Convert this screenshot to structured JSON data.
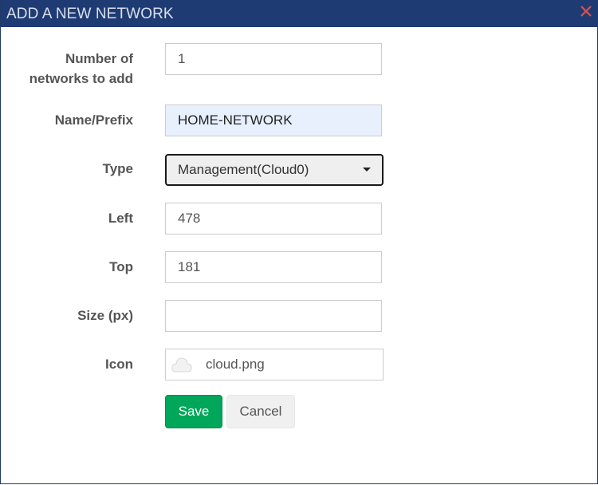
{
  "dialog": {
    "title": "ADD A NEW NETWORK",
    "close_icon": "close-x-icon"
  },
  "form": {
    "count_label_line1": "Number of",
    "count_label_line2": "networks to add",
    "count_value": "1",
    "name_label": "Name/Prefix",
    "name_value": "HOME-NETWORK",
    "type_label": "Type",
    "type_value": "Management(Cloud0)",
    "left_label": "Left",
    "left_value": "478",
    "top_label": "Top",
    "top_value": "181",
    "size_label": "Size (px)",
    "size_value": "",
    "icon_label": "Icon",
    "icon_value": "cloud.png",
    "icon_image": "cloud-icon"
  },
  "buttons": {
    "save_label": "Save",
    "cancel_label": "Cancel"
  },
  "colors": {
    "titlebar": "#1f3b73",
    "save": "#00a65a",
    "close": "#d9534f"
  }
}
